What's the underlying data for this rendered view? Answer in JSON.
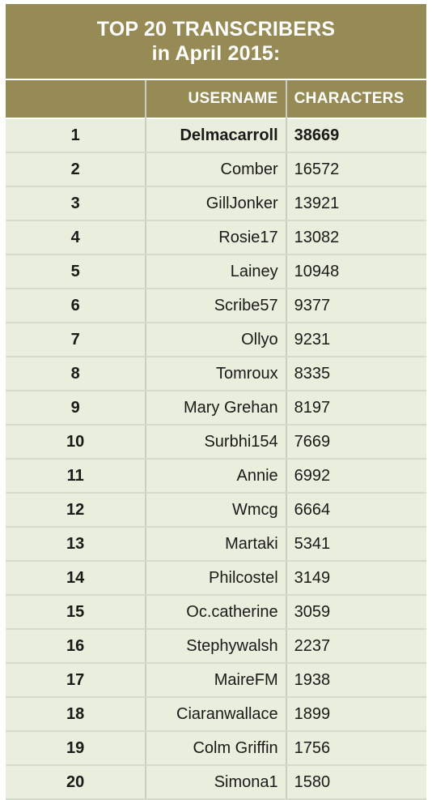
{
  "title": {
    "line1": "TOP 20 TRANSCRIBERS",
    "line2": "in April 2015:"
  },
  "columns": {
    "rank": "",
    "username": "USERNAME",
    "characters": "CHARACTERS"
  },
  "colors": {
    "header_background": "#968a55",
    "header_text": "#ffffff",
    "row_background": "#e9efdc",
    "row_divider": "#d5dbc9",
    "column_divider": "#c9cdc2",
    "body_text": "#1a1a1a",
    "page_background": "#ffffff"
  },
  "chart_data": {
    "type": "table",
    "title": "TOP 20 TRANSCRIBERS in April 2015:",
    "columns": [
      "Rank",
      "USERNAME",
      "CHARACTERS"
    ],
    "categories": [
      "Delmacarroll",
      "Comber",
      "GillJonker",
      "Rosie17",
      "Lainey",
      "Scribe57",
      "Ollyo",
      "Tomroux",
      "Mary Grehan",
      "Surbhi154",
      "Annie",
      "Wmcg",
      "Martaki",
      "Philcostel",
      "Oc.catherine",
      "Stephywalsh",
      "MaireFM",
      "Ciaranwallace",
      "Colm Griffin",
      "Simona1"
    ],
    "values": [
      38669,
      16572,
      13921,
      13082,
      10948,
      9377,
      9231,
      8335,
      8197,
      7669,
      6992,
      6664,
      5341,
      3149,
      3059,
      2237,
      1938,
      1899,
      1756,
      1580
    ],
    "xlabel": "USERNAME",
    "ylabel": "CHARACTERS"
  },
  "rows": [
    {
      "rank": "1",
      "username": "Delmacarroll",
      "characters": "38669",
      "emphasis": true
    },
    {
      "rank": "2",
      "username": "Comber",
      "characters": "16572",
      "emphasis": false
    },
    {
      "rank": "3",
      "username": "GillJonker",
      "characters": "13921",
      "emphasis": false
    },
    {
      "rank": "4",
      "username": "Rosie17",
      "characters": "13082",
      "emphasis": false
    },
    {
      "rank": "5",
      "username": "Lainey",
      "characters": "10948",
      "emphasis": false
    },
    {
      "rank": "6",
      "username": "Scribe57",
      "characters": "9377",
      "emphasis": false
    },
    {
      "rank": "7",
      "username": "Ollyo",
      "characters": "9231",
      "emphasis": false
    },
    {
      "rank": "8",
      "username": "Tomroux",
      "characters": "8335",
      "emphasis": false
    },
    {
      "rank": "9",
      "username": "Mary Grehan",
      "characters": "8197",
      "emphasis": false
    },
    {
      "rank": "10",
      "username": "Surbhi154",
      "characters": "7669",
      "emphasis": false
    },
    {
      "rank": "11",
      "username": "Annie",
      "characters": "6992",
      "emphasis": false
    },
    {
      "rank": "12",
      "username": "Wmcg",
      "characters": "6664",
      "emphasis": false
    },
    {
      "rank": "13",
      "username": "Martaki",
      "characters": "5341",
      "emphasis": false
    },
    {
      "rank": "14",
      "username": "Philcostel",
      "characters": "3149",
      "emphasis": false
    },
    {
      "rank": "15",
      "username": "Oc.catherine",
      "characters": "3059",
      "emphasis": false
    },
    {
      "rank": "16",
      "username": "Stephywalsh",
      "characters": "2237",
      "emphasis": false
    },
    {
      "rank": "17",
      "username": "MaireFM",
      "characters": "1938",
      "emphasis": false
    },
    {
      "rank": "18",
      "username": "Ciaranwallace",
      "characters": "1899",
      "emphasis": false
    },
    {
      "rank": "19",
      "username": "Colm Griffin",
      "characters": "1756",
      "emphasis": false
    },
    {
      "rank": "20",
      "username": "Simona1",
      "characters": "1580",
      "emphasis": false
    }
  ]
}
